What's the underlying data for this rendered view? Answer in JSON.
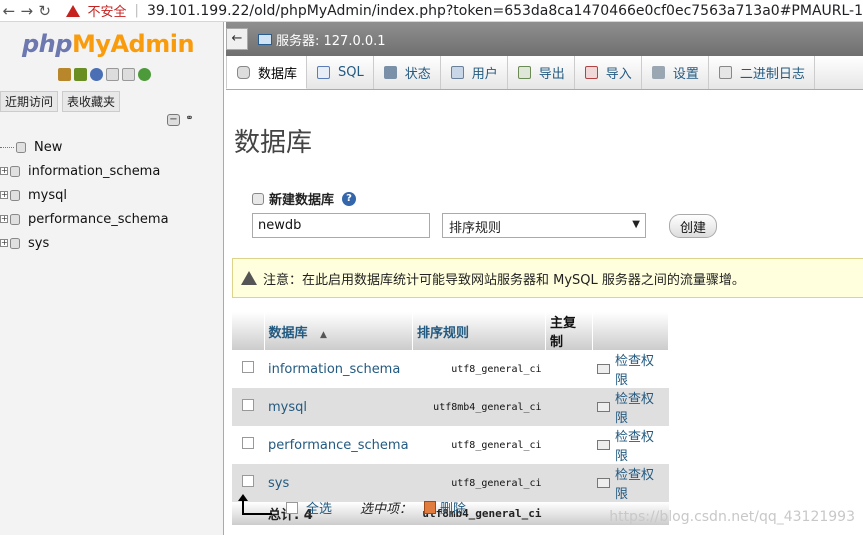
{
  "browser": {
    "security_label": "不安全",
    "url": "39.101.199.22/old/phpMyAdmin/index.php?token=653da8ca1470466e0cf0ec7563a713a0#PMAURL-1"
  },
  "sidebar": {
    "logo_php": "php",
    "logo_myadmin": "MyAdmin",
    "tab_recent": "近期访问",
    "tab_favorites": "表收藏夹",
    "tree": [
      {
        "label": "New"
      },
      {
        "label": "information_schema"
      },
      {
        "label": "mysql"
      },
      {
        "label": "performance_schema"
      },
      {
        "label": "sys"
      }
    ]
  },
  "header": {
    "server": "服务器: 127.0.0.1"
  },
  "tabs": [
    {
      "label": "数据库",
      "icon": "database-icon"
    },
    {
      "label": "SQL",
      "icon": "sql-icon"
    },
    {
      "label": "状态",
      "icon": "status-icon"
    },
    {
      "label": "用户",
      "icon": "users-icon"
    },
    {
      "label": "导出",
      "icon": "export-icon"
    },
    {
      "label": "导入",
      "icon": "import-icon"
    },
    {
      "label": "设置",
      "icon": "settings-icon"
    },
    {
      "label": "二进制日志",
      "icon": "binlog-icon"
    }
  ],
  "main": {
    "title": "数据库",
    "create": {
      "label": "新建数据库",
      "db_name_value": "newdb",
      "collation_placeholder": "排序规则",
      "button": "创建"
    },
    "notice": "注意：在此启用数据库统计可能导致网站服务器和 MySQL 服务器之间的流量骤增。",
    "table": {
      "headers": {
        "database": "数据库",
        "collation": "排序规则",
        "master": "主复制"
      },
      "rows": [
        {
          "name": "information_schema",
          "collation": "utf8_general_ci",
          "action": "检查权限"
        },
        {
          "name": "mysql",
          "collation": "utf8mb4_general_ci",
          "action": "检查权限"
        },
        {
          "name": "performance_schema",
          "collation": "utf8_general_ci",
          "action": "检查权限"
        },
        {
          "name": "sys",
          "collation": "utf8_general_ci",
          "action": "检查权限"
        }
      ],
      "total_label": "总计: 4",
      "total_collation": "utf8mb4_general_ci"
    },
    "bulk": {
      "select_all": "全选",
      "with_selected": "选中项：",
      "drop": "删除"
    }
  },
  "watermark": "https://blog.csdn.net/qq_43121993"
}
